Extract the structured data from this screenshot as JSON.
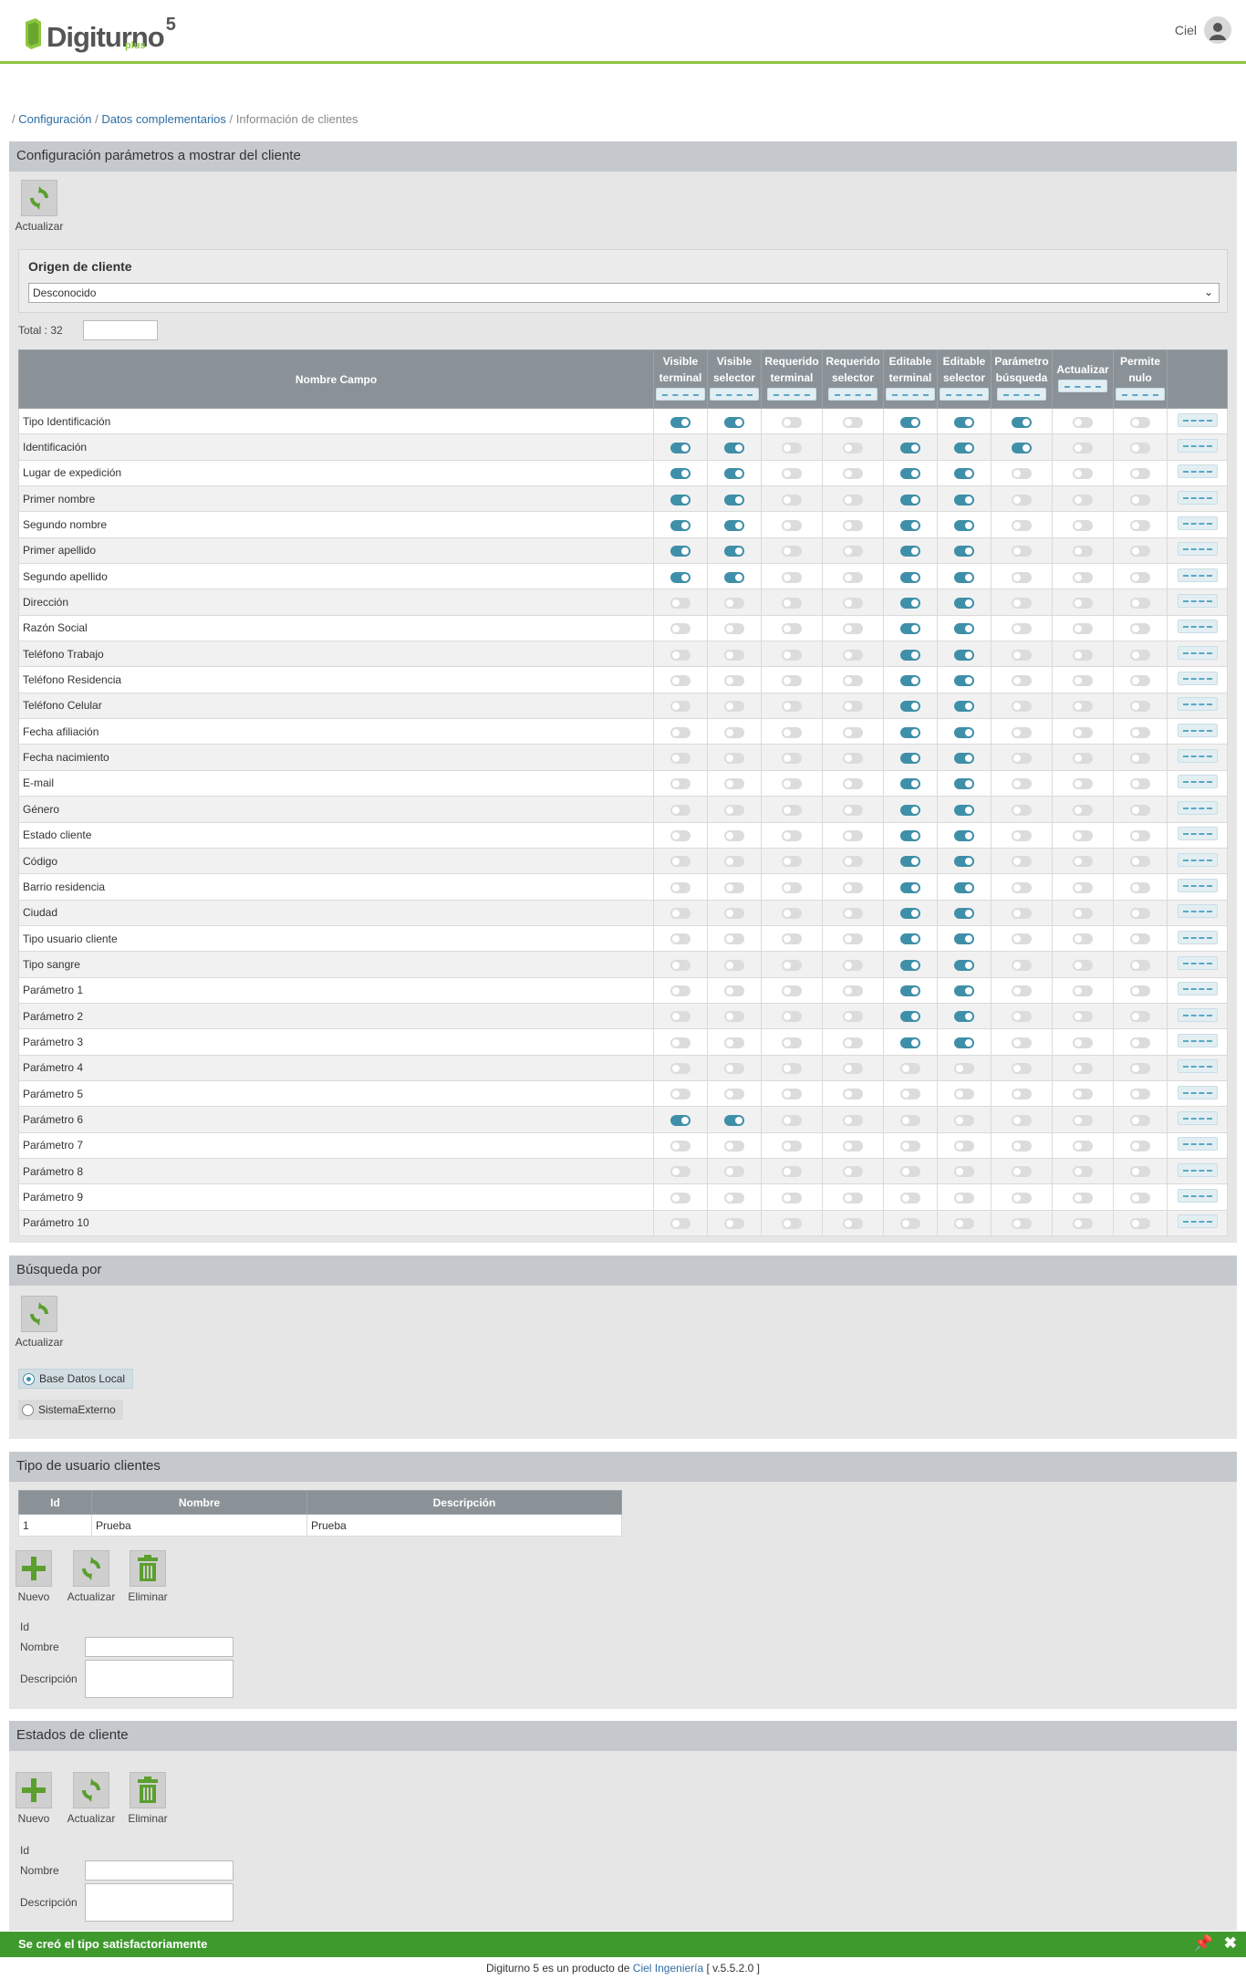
{
  "header": {
    "logo_text": "Digiturno",
    "logo_version": "5",
    "logo_plus": "plus",
    "user_name": "Ciel"
  },
  "breadcrumb": {
    "sep": "/",
    "item1": "Configuración",
    "item2": "Datos complementarios",
    "current": "Información de clientes"
  },
  "config_panel": {
    "title": "Configuración parámetros a mostrar del cliente",
    "refresh_label": "Actualizar",
    "origin_label": "Origen de cliente",
    "origin_value": "Desconocido",
    "total_label": "Total :",
    "total_count": "32",
    "columns": [
      "Nombre Campo",
      "Visible terminal",
      "Visible selector",
      "Requerido terminal",
      "Requerido selector",
      "Editable terminal",
      "Editable selector",
      "Parámetro búsqueda",
      "Actualizar",
      "Permite nulo"
    ],
    "rows": [
      {
        "name": "Tipo Identificación",
        "flags": [
          1,
          1,
          0,
          0,
          1,
          1,
          1,
          0,
          0
        ]
      },
      {
        "name": "Identificación",
        "flags": [
          1,
          1,
          0,
          0,
          1,
          1,
          1,
          0,
          0
        ]
      },
      {
        "name": "Lugar de expedición",
        "flags": [
          1,
          1,
          0,
          0,
          1,
          1,
          0,
          0,
          0
        ]
      },
      {
        "name": "Primer nombre",
        "flags": [
          1,
          1,
          0,
          0,
          1,
          1,
          0,
          0,
          0
        ]
      },
      {
        "name": "Segundo nombre",
        "flags": [
          1,
          1,
          0,
          0,
          1,
          1,
          0,
          0,
          0
        ]
      },
      {
        "name": "Primer apellido",
        "flags": [
          1,
          1,
          0,
          0,
          1,
          1,
          0,
          0,
          0
        ]
      },
      {
        "name": "Segundo apellido",
        "flags": [
          1,
          1,
          0,
          0,
          1,
          1,
          0,
          0,
          0
        ]
      },
      {
        "name": "Dirección",
        "flags": [
          0,
          0,
          0,
          0,
          1,
          1,
          0,
          0,
          0
        ]
      },
      {
        "name": "Razón Social",
        "flags": [
          0,
          0,
          0,
          0,
          1,
          1,
          0,
          0,
          0
        ]
      },
      {
        "name": "Teléfono Trabajo",
        "flags": [
          0,
          0,
          0,
          0,
          1,
          1,
          0,
          0,
          0
        ]
      },
      {
        "name": "Teléfono Residencia",
        "flags": [
          0,
          0,
          0,
          0,
          1,
          1,
          0,
          0,
          0
        ]
      },
      {
        "name": "Teléfono Celular",
        "flags": [
          0,
          0,
          0,
          0,
          1,
          1,
          0,
          0,
          0
        ]
      },
      {
        "name": "Fecha afiliación",
        "flags": [
          0,
          0,
          0,
          0,
          1,
          1,
          0,
          0,
          0
        ]
      },
      {
        "name": "Fecha nacimiento",
        "flags": [
          0,
          0,
          0,
          0,
          1,
          1,
          0,
          0,
          0
        ]
      },
      {
        "name": "E-mail",
        "flags": [
          0,
          0,
          0,
          0,
          1,
          1,
          0,
          0,
          0
        ]
      },
      {
        "name": "Género",
        "flags": [
          0,
          0,
          0,
          0,
          1,
          1,
          0,
          0,
          0
        ]
      },
      {
        "name": "Estado cliente",
        "flags": [
          0,
          0,
          0,
          0,
          1,
          1,
          0,
          0,
          0
        ]
      },
      {
        "name": "Código",
        "flags": [
          0,
          0,
          0,
          0,
          1,
          1,
          0,
          0,
          0
        ]
      },
      {
        "name": "Barrio residencia",
        "flags": [
          0,
          0,
          0,
          0,
          1,
          1,
          0,
          0,
          0
        ]
      },
      {
        "name": "Ciudad",
        "flags": [
          0,
          0,
          0,
          0,
          1,
          1,
          0,
          0,
          0
        ]
      },
      {
        "name": "Tipo usuario cliente",
        "flags": [
          0,
          0,
          0,
          0,
          1,
          1,
          0,
          0,
          0
        ]
      },
      {
        "name": "Tipo sangre",
        "flags": [
          0,
          0,
          0,
          0,
          1,
          1,
          0,
          0,
          0
        ]
      },
      {
        "name": "Parámetro 1",
        "flags": [
          0,
          0,
          0,
          0,
          1,
          1,
          0,
          0,
          0
        ]
      },
      {
        "name": "Parámetro 2",
        "flags": [
          0,
          0,
          0,
          0,
          1,
          1,
          0,
          0,
          0
        ]
      },
      {
        "name": "Parámetro 3",
        "flags": [
          0,
          0,
          0,
          0,
          1,
          1,
          0,
          0,
          0
        ]
      },
      {
        "name": "Parámetro 4",
        "flags": [
          0,
          0,
          0,
          0,
          0,
          0,
          0,
          0,
          0
        ]
      },
      {
        "name": "Parámetro 5",
        "flags": [
          0,
          0,
          0,
          0,
          0,
          0,
          0,
          0,
          0
        ]
      },
      {
        "name": "Parámetro 6",
        "flags": [
          1,
          1,
          0,
          0,
          0,
          0,
          0,
          0,
          0
        ]
      },
      {
        "name": "Parámetro 7",
        "flags": [
          0,
          0,
          0,
          0,
          0,
          0,
          0,
          0,
          0
        ]
      },
      {
        "name": "Parámetro 8",
        "flags": [
          0,
          0,
          0,
          0,
          0,
          0,
          0,
          0,
          0
        ]
      },
      {
        "name": "Parámetro 9",
        "flags": [
          0,
          0,
          0,
          0,
          0,
          0,
          0,
          0,
          0
        ]
      },
      {
        "name": "Parámetro 10",
        "flags": [
          0,
          0,
          0,
          0,
          0,
          0,
          0,
          0,
          0
        ]
      }
    ]
  },
  "search_panel": {
    "title": "Búsqueda por",
    "refresh_label": "Actualizar",
    "option_local": "Base Datos Local",
    "option_external": "SistemaExterno",
    "selected": "Base Datos Local"
  },
  "user_types_panel": {
    "title": "Tipo de usuario clientes",
    "columns": [
      "Id",
      "Nombre",
      "Descripción"
    ],
    "rows": [
      {
        "id": "1",
        "name": "Prueba",
        "description": "Prueba"
      }
    ],
    "new_label": "Nuevo",
    "refresh_label": "Actualizar",
    "delete_label": "Eliminar",
    "id_label": "Id",
    "name_label": "Nombre",
    "desc_label": "Descripción"
  },
  "client_states_panel": {
    "title": "Estados de cliente",
    "new_label": "Nuevo",
    "refresh_label": "Actualizar",
    "delete_label": "Eliminar",
    "id_label": "Id",
    "name_label": "Nombre",
    "desc_label": "Descripción"
  },
  "toast": {
    "message": "Se creó el tipo satisfactoriamente"
  },
  "footer": {
    "prefix": "Digiturno 5 es un producto de",
    "link": "Ciel Ingeniería",
    "version": "[ v.5.5.2.0 ]"
  },
  "colors": {
    "brand_green": "#8dc63f",
    "toggle_on": "#3f8fa8",
    "toast_green": "#3f9a2e",
    "header_gray": "#8a9297"
  }
}
